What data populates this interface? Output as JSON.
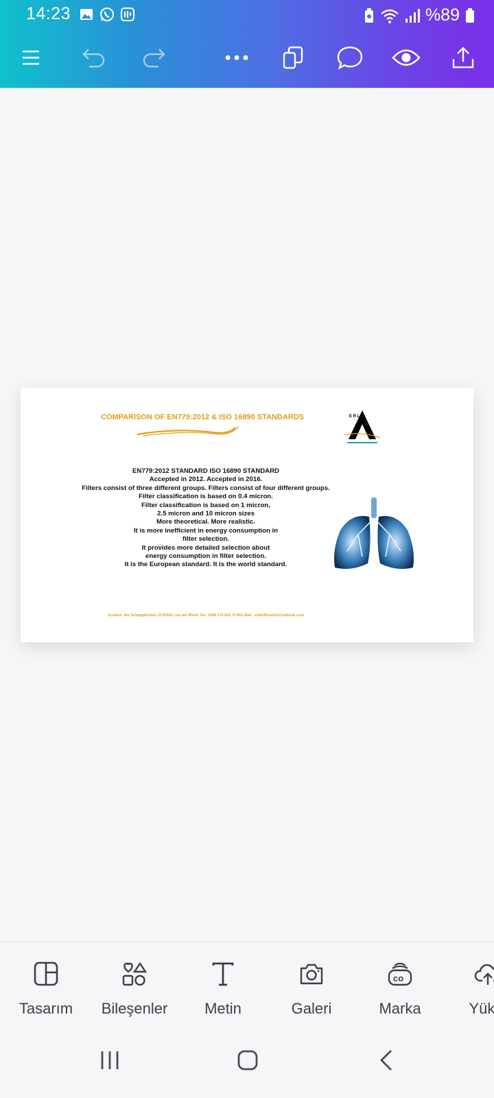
{
  "status_bar": {
    "time": "14:23",
    "battery_text": "%89",
    "icons": [
      "gallery-icon",
      "whatsapp-icon",
      "app-icon",
      "battery-saver-icon",
      "wifi-icon",
      "signal-icon",
      "battery-icon"
    ]
  },
  "toolbar": {
    "icons": [
      "menu-icon",
      "undo-icon",
      "redo-icon",
      "more-icon",
      "pages-icon",
      "comment-icon",
      "preview-icon",
      "share-icon"
    ]
  },
  "document": {
    "title": "COMPARISON OF EN779:2012 & ISO 16890 STANDARDS",
    "logo_letters": "E R L",
    "logo_sub": "AIR",
    "logo_sub2": "FILTER",
    "body_lines": [
      "EN779:2012 STANDARD ISO 16890 STANDARD",
      "Accepted in 2012. Accepted in 2016.",
      "Filters consist of three different groups. Filters consist of four different groups.",
      "Filter classification is based on 0.4 micron.",
      "Filter classification is based on 1 micron,",
      "2.5 micron and 10 micron sizes",
      "More theoretical. More realistic.",
      "It is more inefficient in energy consumption in",
      "filter selection.",
      "It provides more detailed selection about",
      "energy consumption in filter selection.",
      "It is the European standard. It is the world standard."
    ],
    "contact": "Contact: Am Schoppbüchel 19 53545 Linz am Rhein    Tel.: 0049 176 625 74 851  Mail : erlairfiltration@outlook.com"
  },
  "bottom_nav": [
    {
      "label": "Tasarım",
      "icon": "layout-icon"
    },
    {
      "label": "Bileşenler",
      "icon": "elements-icon"
    },
    {
      "label": "Metin",
      "icon": "text-icon"
    },
    {
      "label": "Galeri",
      "icon": "camera-icon"
    },
    {
      "label": "Marka",
      "icon": "brand-icon"
    },
    {
      "label": "Yükle",
      "icon": "upload-icon"
    }
  ],
  "colors": {
    "accent_orange": "#e59a16",
    "header_gradient_start": "#0fc1cc",
    "header_gradient_end": "#7a2fe8"
  }
}
